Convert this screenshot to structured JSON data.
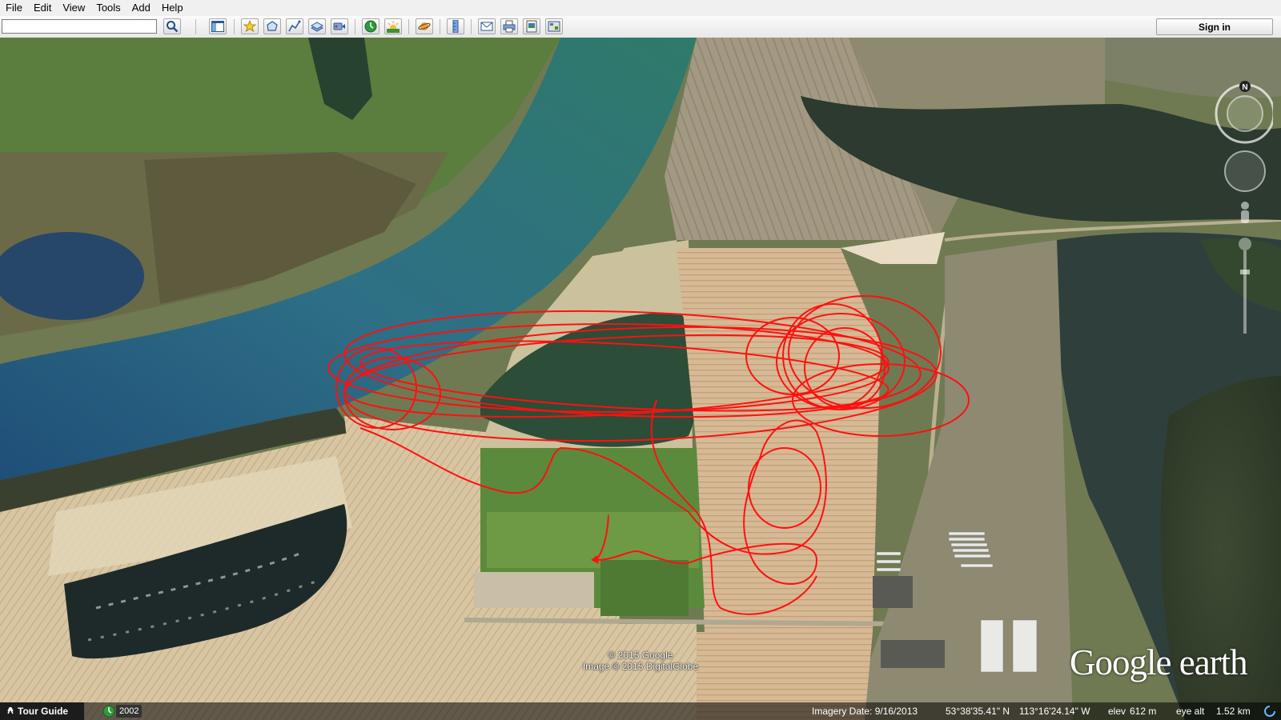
{
  "menu": {
    "items": [
      "File",
      "Edit",
      "View",
      "Tools",
      "Add",
      "Help"
    ]
  },
  "search": {
    "placeholder": "",
    "value": ""
  },
  "toolbar": {
    "icons": [
      "search-icon",
      "sidebar-icon",
      "placemark-icon",
      "polygon-icon",
      "path-icon",
      "overlay-icon",
      "record-tour-icon",
      "historical-imagery-icon",
      "sunlight-icon",
      "planets-icon",
      "ruler-icon",
      "email-icon",
      "print-icon",
      "save-image-icon",
      "maps-icon"
    ],
    "sign_in_label": "Sign in"
  },
  "map": {
    "copyright_line1": "© 2015 Google",
    "copyright_line2": "Image © 2015 DigitalGlobe",
    "logo": "Google earth",
    "track_color": "#ff1010",
    "compass_label": "N"
  },
  "status": {
    "tour_guide_label": "Tour Guide",
    "historical_year": "2002",
    "imagery_date": "Imagery Date: 9/16/2013",
    "latitude": "53°38'35.41\" N",
    "longitude": "113°16'24.14\" W",
    "elevation_label": "elev",
    "elevation_value": "612 m",
    "eye_alt_label": "eye alt",
    "eye_alt_value": "1.52 km"
  }
}
